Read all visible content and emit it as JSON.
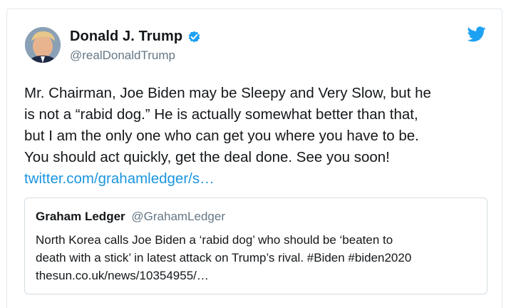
{
  "author": {
    "display_name": "Donald J. Trump",
    "handle": "@realDonaldTrump",
    "verified": true
  },
  "tweet": {
    "text_lines": [
      "Mr. Chairman, Joe Biden may be Sleepy and Very Slow, but he",
      "is not a “rabid dog.” He is actually somewhat better than that,",
      "but I am the only one who can get you where you have to be.",
      "You should act quickly, get the deal done. See you soon!"
    ],
    "link": "twitter.com/grahamledger/s…"
  },
  "quoted_tweet": {
    "display_name": "Graham Ledger",
    "handle": "@GrahamLedger",
    "text_lines": [
      "North Korea calls Joe Biden a ‘rabid dog’ who should be ‘beaten to",
      "death with a stick’ in latest attack on Trump’s rival. #Biden #biden2020",
      "thesun.co.uk/news/10354955/…"
    ]
  },
  "icons": {
    "verified": "verified-badge-icon",
    "brand": "twitter-bird-icon"
  },
  "colors": {
    "link": "#1b95e0",
    "verified": "#1da1f2",
    "brand": "#1da1f2",
    "text": "#14171a",
    "secondary": "#657786"
  }
}
